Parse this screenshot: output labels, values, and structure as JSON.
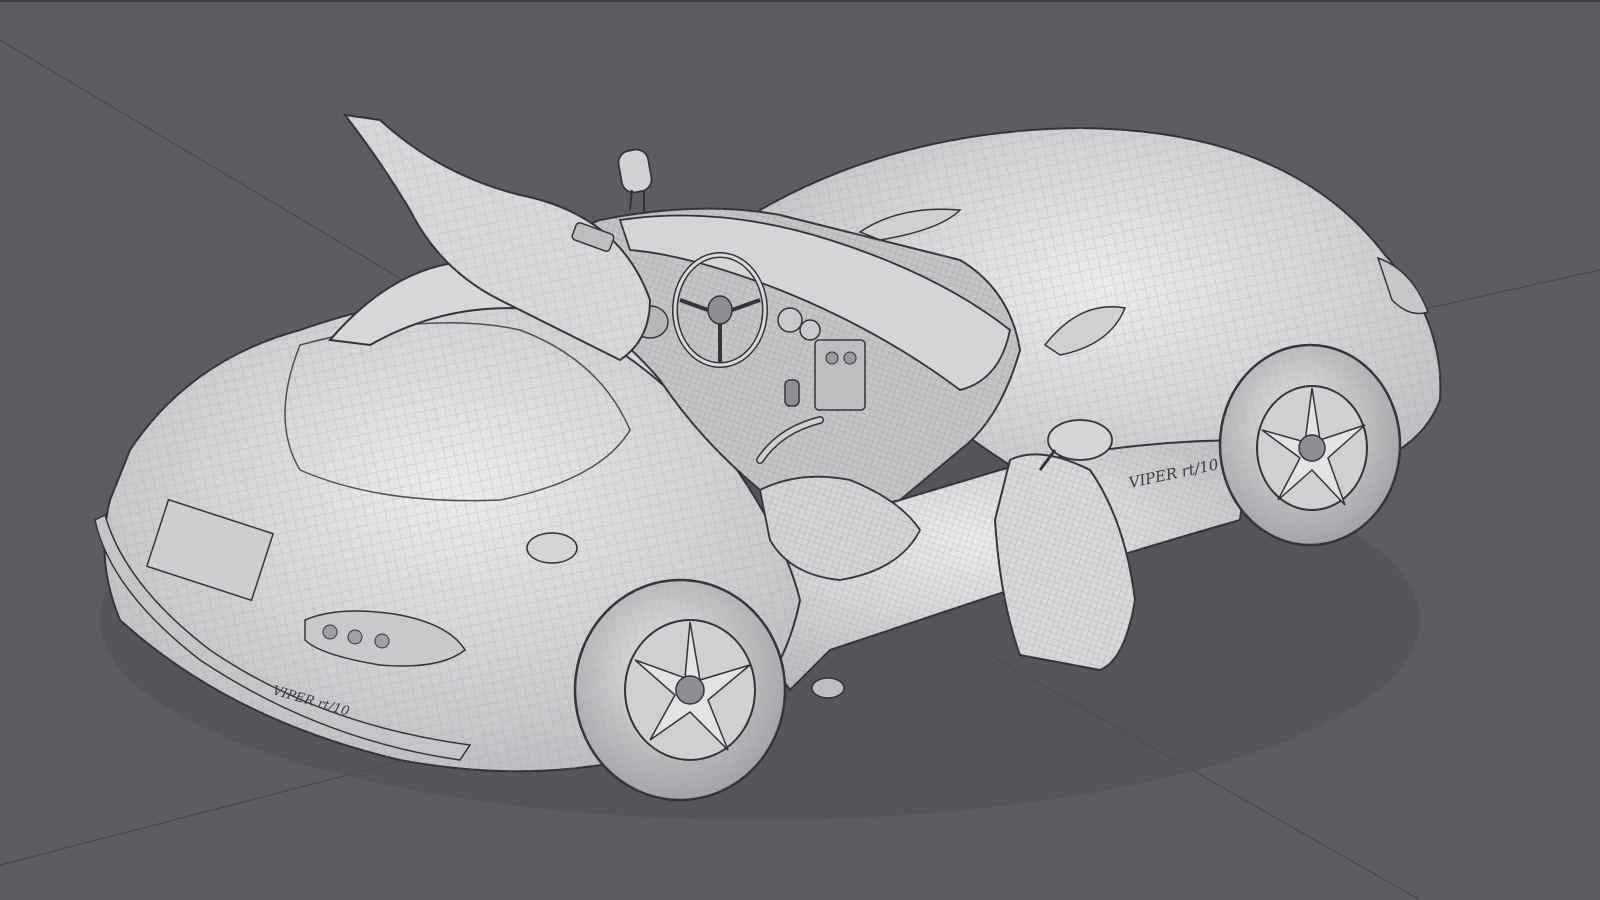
{
  "viewport": {
    "title": "",
    "background_color": "#5c5d61",
    "surface_color": "#d9dadb",
    "wire_color": "#9b9ca0",
    "outline_color": "#333438",
    "grid_line_color": "#45464a"
  },
  "scene": {
    "subject": "car-3d-wireframe-model",
    "badges": [
      {
        "name": "side-badge",
        "text": "VIPER rt/10"
      },
      {
        "name": "rear-badge",
        "text": "VIPER rt/10"
      }
    ]
  }
}
